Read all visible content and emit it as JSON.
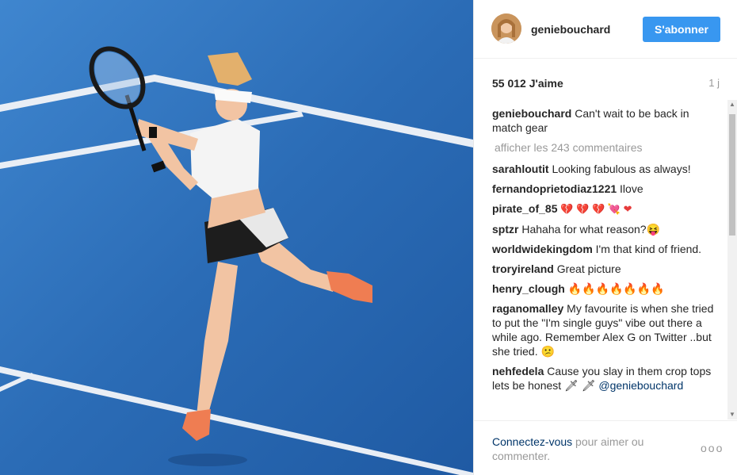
{
  "header": {
    "username": "geniebouchard",
    "follow_label": "S'abonner",
    "avatar_icon": "avatar-icon"
  },
  "post": {
    "likes": "55 012 J'aime",
    "age": "1 j",
    "caption_user": "geniebouchard",
    "caption_text": "Can't wait to be back in match gear",
    "view_all": "afficher les 243 commentaires"
  },
  "comments": [
    {
      "user": "sarahloutit",
      "text": "Looking fabulous as always!"
    },
    {
      "user": "fernandoprietodiaz1221",
      "text": "Ilove"
    },
    {
      "user": "pirate_of_85",
      "text": "💔 💔 💔 💘 ❤"
    },
    {
      "user": "sptzr",
      "text": "Hahaha for what reason?😝"
    },
    {
      "user": "worldwidekingdom",
      "text": "I'm that kind of friend."
    },
    {
      "user": "troryireland",
      "text": "Great picture"
    },
    {
      "user": "henry_clough",
      "text": "🔥🔥🔥🔥🔥🔥🔥"
    },
    {
      "user": "raganomalley",
      "text": "My favourite is when she tried to put the \"I'm single guys\" vibe out there a while ago. Remember Alex G on Twitter ..but she tried. 😕"
    },
    {
      "user": "nehfedela",
      "text": "Cause you slay in them crop tops lets be honest 🗡 🗡",
      "mention": "@geniebouchard"
    }
  ],
  "footer": {
    "login_link": "Connectez-vous",
    "login_rest": " pour aimer ou commenter.",
    "more_label": "ooo"
  },
  "colors": {
    "accent": "#3897f0",
    "court": "#2c6db5",
    "link": "#003569"
  }
}
